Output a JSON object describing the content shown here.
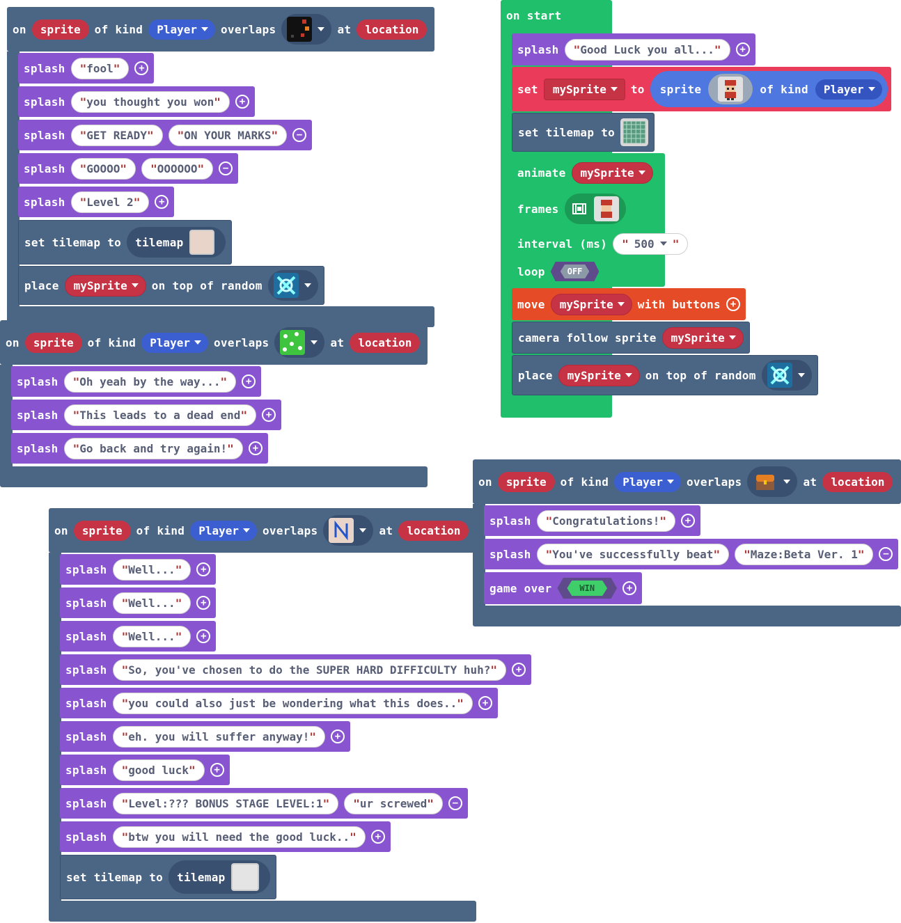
{
  "kw": {
    "on": "on",
    "sprite": "sprite",
    "of_kind": "of kind",
    "overlaps": "overlaps",
    "at": "at",
    "location": "location",
    "splash": "splash",
    "set_tilemap_to": "set tilemap to",
    "tilemap": "tilemap",
    "place": "place",
    "on_top_of_random": "on top of random",
    "on_start": "on start",
    "set": "set",
    "to": "to",
    "animate": "animate",
    "frames": "frames",
    "interval": "interval (ms)",
    "loop": "loop",
    "move": "move",
    "with_buttons": "with buttons",
    "camera_follow": "camera follow sprite",
    "game_over": "game over",
    "kind_player": "Player",
    "var": "mySprite"
  },
  "block1": {
    "splashes": [
      [
        "fool"
      ],
      [
        "you thought you won"
      ],
      [
        "GET READY",
        "ON YOUR MARKS"
      ],
      [
        "GOOOO",
        "OOOOOO"
      ],
      [
        "Level 2"
      ]
    ]
  },
  "block2": {
    "splashes": [
      [
        "Oh yeah by the way..."
      ],
      [
        "This leads to a dead end"
      ],
      [
        "Go back and try again!"
      ]
    ]
  },
  "block3": {
    "splashes": [
      [
        "Well..."
      ],
      [
        "Well..."
      ],
      [
        "Well..."
      ],
      [
        "So, you've chosen to do the SUPER HARD DIFFICULTY huh?"
      ],
      [
        "you could also just be wondering what this does.."
      ],
      [
        "eh. you will suffer anyway!"
      ],
      [
        "good luck"
      ],
      [
        "Level:??? BONUS STAGE LEVEL:1",
        "ur screwed"
      ],
      [
        "btw you will need the good luck.."
      ]
    ]
  },
  "start": {
    "splash": "Good Luck you all...",
    "interval": "500",
    "loop_state": "OFF"
  },
  "block4": {
    "splashes": [
      [
        "Congratulations!"
      ],
      [
        "You've successfully beat",
        "Maze:Beta Ver. 1"
      ]
    ],
    "win": "WIN"
  },
  "icons": [
    "plus-icon",
    "minus-icon",
    "dropdown-caret-icon",
    "film-icon"
  ]
}
